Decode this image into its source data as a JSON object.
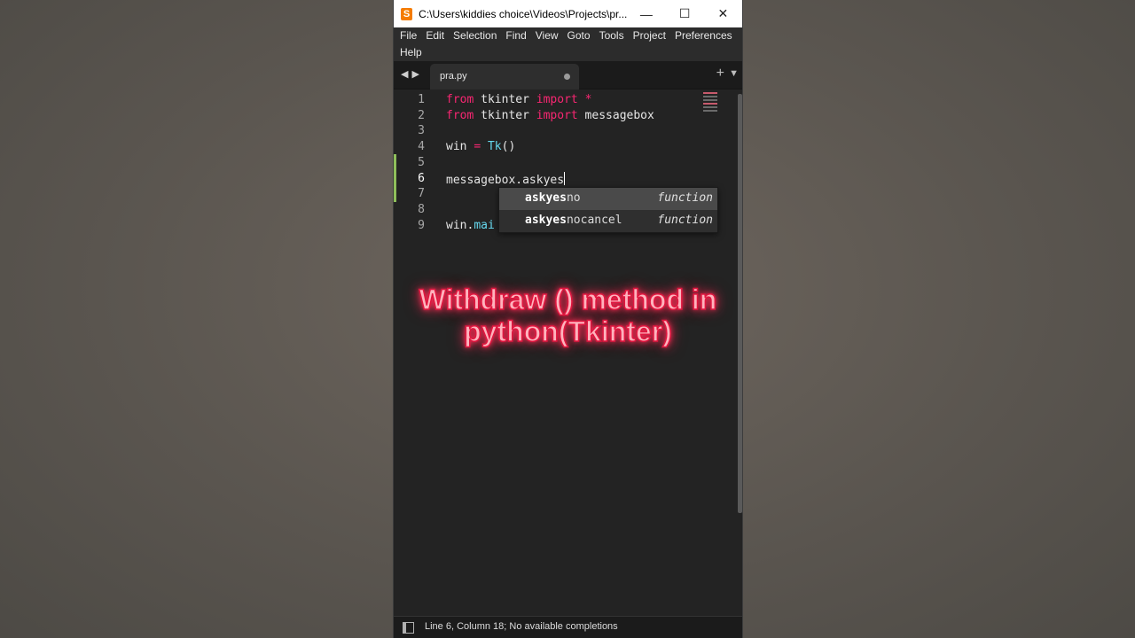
{
  "window": {
    "title": "C:\\Users\\kiddies choice\\Videos\\Projects\\pr...",
    "app_icon_letter": "S",
    "controls": {
      "minimize": "—",
      "maximize": "☐",
      "close": "✕"
    }
  },
  "menu": [
    "File",
    "Edit",
    "Selection",
    "Find",
    "View",
    "Goto",
    "Tools",
    "Project",
    "Preferences",
    "Help"
  ],
  "tabs": {
    "nav": "◀▶",
    "active_tab": "pra.py",
    "new_tab": "+",
    "dropdown": "▼"
  },
  "editor": {
    "current_line": 6,
    "lines": [
      {
        "number": "1",
        "tokens": [
          [
            "kw",
            "from"
          ],
          [
            "ident",
            " tkinter "
          ],
          [
            "kw",
            "import"
          ],
          [
            "ident",
            " "
          ],
          [
            "op",
            "*"
          ]
        ]
      },
      {
        "number": "2",
        "tokens": [
          [
            "kw",
            "from"
          ],
          [
            "ident",
            " tkinter "
          ],
          [
            "kw",
            "import"
          ],
          [
            "ident",
            " messagebox"
          ]
        ]
      },
      {
        "number": "3",
        "tokens": []
      },
      {
        "number": "4",
        "tokens": [
          [
            "ident",
            "win "
          ],
          [
            "op",
            "="
          ],
          [
            "ident",
            " "
          ],
          [
            "fn",
            "Tk"
          ],
          [
            "ident",
            "()"
          ]
        ]
      },
      {
        "number": "5",
        "tokens": []
      },
      {
        "number": "6",
        "tokens": [
          [
            "ident",
            "messagebox.askyes"
          ]
        ]
      },
      {
        "number": "7",
        "tokens": []
      },
      {
        "number": "8",
        "tokens": []
      },
      {
        "number": "9",
        "tokens": [
          [
            "ident",
            "win."
          ],
          [
            "fn",
            "mai"
          ]
        ]
      }
    ]
  },
  "autocomplete": {
    "items": [
      {
        "match": "askyes",
        "rest": "no",
        "kind": "function",
        "selected": true
      },
      {
        "match": "askyes",
        "rest": "nocancel",
        "kind": "function",
        "selected": false
      }
    ]
  },
  "overlay": {
    "line1": "Withdraw () method in",
    "line2": "python(Tkinter)"
  },
  "status": {
    "text": "Line 6, Column 18; No available completions"
  },
  "colors": {
    "keyword": "#f92672",
    "function": "#66d9ef",
    "background": "#232323",
    "overlay_glow": "#ff2d55"
  }
}
